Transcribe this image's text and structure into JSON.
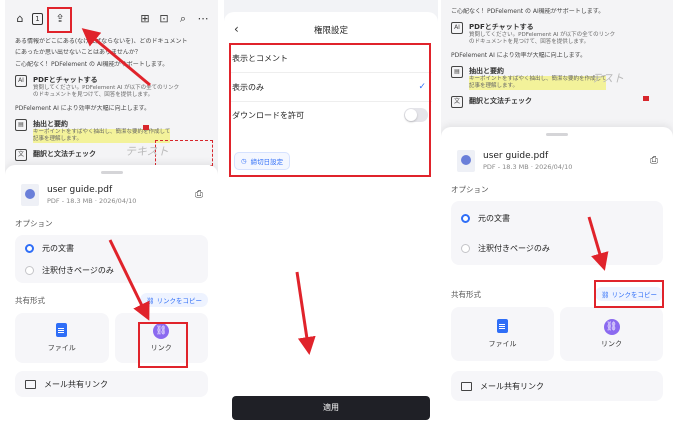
{
  "document": {
    "line1": "ある情報がどこにある(なければならないを)、どのドキュメント",
    "line2": "にあったか思い出せないことはありませんか？",
    "line3": "ご心配なく！PDFelement の AI機能がサポートします。",
    "item1_title": "PDFとチャットする",
    "item1_sub1": "質問してください。PDFelement AI が以下の全てのリンク",
    "item1_sub2": "のドキュメントを見つけて、回答を提供します。",
    "line4": "PDFelement AI により効率が大幅に向上します。",
    "item2_title": "抽出と要約",
    "item2_sub1": "キーポイントをすばやく抽出し、簡潔な要約を作成して",
    "item2_sub2": "記事を理解します。",
    "item3_title": "翻訳と文法チェック",
    "scribble": "テキスト",
    "scribble2": "テスト"
  },
  "toolbar": {
    "icons": [
      "home-icon",
      "page-number-icon",
      "share-icon",
      "extract-icon",
      "bookmark-icon",
      "search-icon",
      "more-icon"
    ],
    "page_number": "1"
  },
  "sheet": {
    "file_name": "user guide.pdf",
    "file_meta": "PDF - 18.3 MB · 2026/04/10",
    "options_label": "オプション",
    "option_original": "元の文書",
    "option_annotated": "注釈付きページのみ",
    "share_label": "共有形式",
    "copy_link": "リンクをコピー",
    "file_card": "ファイル",
    "link_card": "リンク",
    "mail_link": "メール共有リンク"
  },
  "permissions": {
    "title": "権限設定",
    "view_comment": "表示とコメント",
    "view_only": "表示のみ",
    "allow_download": "ダウンロードを許可",
    "expiry": "締切日設定",
    "apply": "適用"
  },
  "colors": {
    "accent": "#2f6ef7",
    "highlight": "#e0232b",
    "link_icon": "#8b6af0",
    "apply_button": "#1f2026"
  }
}
